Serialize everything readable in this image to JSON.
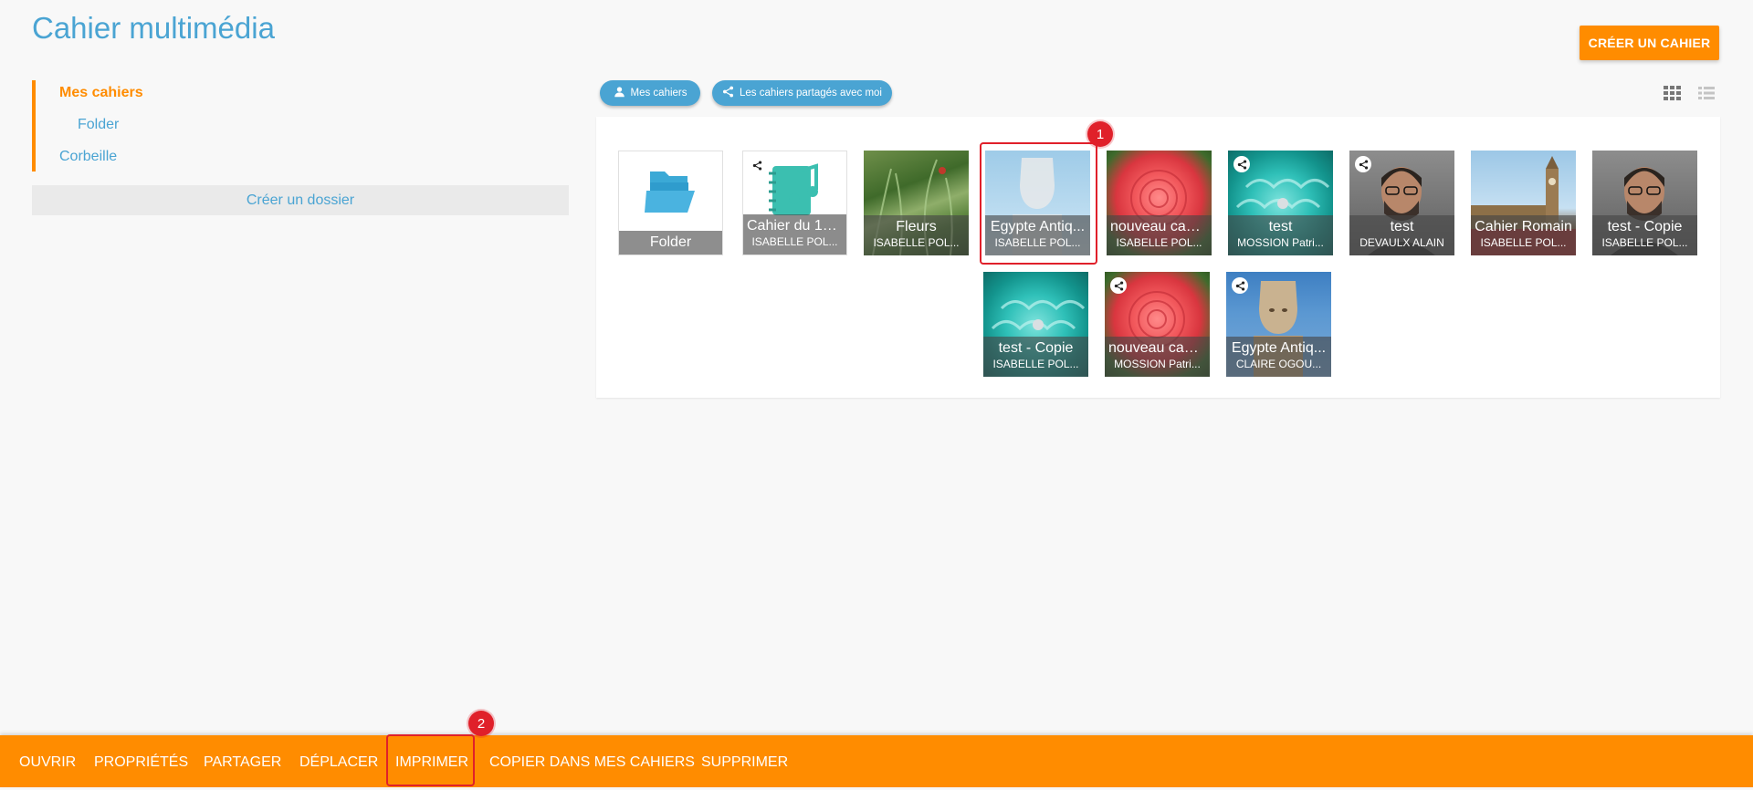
{
  "header": {
    "title": "Cahier multimédia",
    "create_label": "CRÉER UN CAHIER"
  },
  "sidebar": {
    "items": [
      {
        "label": "Mes cahiers",
        "active": true
      },
      {
        "label": "Folder"
      },
      {
        "label": "Corbeille"
      }
    ],
    "new_folder_label": "Créer un dossier"
  },
  "filters": {
    "mine_label": "Mes cahiers",
    "shared_label": "Les cahiers partagés avec moi"
  },
  "view_toggle": {
    "grid_icon": "grid-icon",
    "list_icon": "list-icon"
  },
  "tiles": [
    {
      "title": "Folder",
      "owner": "",
      "kind": "folder",
      "icon": "folder-open-icon"
    },
    {
      "title": "Cahier du 15 ...",
      "owner": "ISABELLE POL...",
      "kind": "notebook",
      "shared": true,
      "icon": "music-notebook-icon"
    },
    {
      "title": "Fleurs",
      "owner": "ISABELLE POL...",
      "kind": "grass"
    },
    {
      "title": "Egypte Antiq...",
      "owner": "ISABELLE POL...",
      "kind": "statue-light",
      "selected": true
    },
    {
      "title": "nouveau cahi...",
      "owner": "ISABELLE POL...",
      "kind": "rose"
    },
    {
      "title": "test",
      "owner": "MOSSION Patri...",
      "kind": "cupcake",
      "shared": true
    },
    {
      "title": "test",
      "owner": "DEVAULX ALAIN",
      "kind": "portrait",
      "shared": true
    },
    {
      "title": "Cahier Romain",
      "owner": "ISABELLE POL...",
      "kind": "london"
    },
    {
      "title": "test - Copie",
      "owner": "ISABELLE POL...",
      "kind": "portrait"
    },
    {
      "title": "test - Copie",
      "owner": "ISABELLE POL...",
      "kind": "cupcake"
    },
    {
      "title": "nouveau cahi...",
      "owner": "MOSSION Patri...",
      "kind": "rose",
      "shared": true
    },
    {
      "title": "Egypte Antiq...",
      "owner": "CLAIRE OGOU...",
      "kind": "statue",
      "shared": true
    }
  ],
  "markers": [
    "1",
    "2"
  ],
  "actions": [
    "OUVRIR",
    "PROPRIÉTÉS",
    "PARTAGER",
    "DÉPLACER",
    "IMPRIMER",
    "COPIER DANS MES CAHIERS",
    "SUPPRIMER"
  ],
  "colors": {
    "accent": "#ff8c00",
    "link": "#4aa4d3",
    "highlight": "#e0202a"
  }
}
